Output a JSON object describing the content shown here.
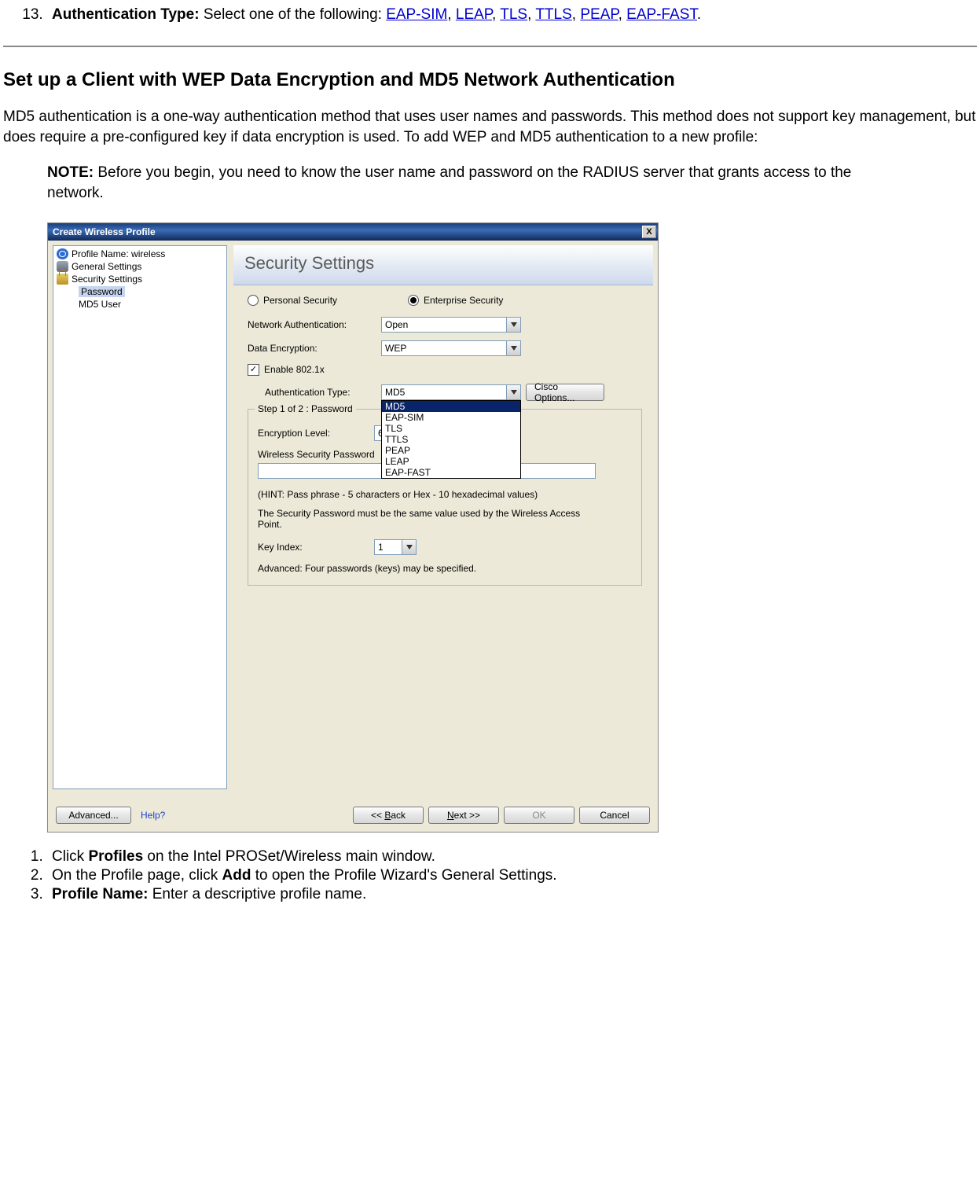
{
  "intro_list": {
    "item13": {
      "num": "13.",
      "label": "Authentication Type:",
      "tail": " Select one of the following: ",
      "links": [
        "EAP-SIM",
        "LEAP",
        "TLS",
        "TTLS",
        "PEAP",
        "EAP-FAST"
      ],
      "sep": ", ",
      "end": "."
    }
  },
  "section_heading": "Set up a Client with WEP Data Encryption and MD5 Network Authentication",
  "section_para": "MD5 authentication is a one-way authentication method that uses user names and passwords. This method does not support key management, but does require a pre-configured key if data encryption is used. To add WEP and MD5 authentication to a new profile:",
  "note": {
    "label": "NOTE:",
    "text": " Before you begin, you need to know the user name and password on the RADIUS server that grants access to the network."
  },
  "dialog": {
    "title": "Create Wireless Profile",
    "close_glyph": "X",
    "tree": {
      "row0": "Profile Name: wireless",
      "row1": "General Settings",
      "row2": "Security Settings",
      "row3": "Password",
      "row4": "MD5 User"
    },
    "header": "Security Settings",
    "radios": {
      "personal": "Personal Security",
      "enterprise": "Enterprise Security"
    },
    "labels": {
      "net_auth": "Network Authentication:",
      "data_enc": "Data Encryption:",
      "enable_8021x": "Enable 802.1x",
      "auth_type": "Authentication Type:",
      "enc_level": "Encryption Level:",
      "wsp": "Wireless Security Password",
      "hint": "(HINT: Pass phrase - 5 characters or Hex - 10 hexadecimal values)",
      "same_val": "The Security Password must be the same value used by the Wireless Access Point.",
      "key_index": "Key Index:",
      "advanced_note": "Advanced: Four passwords (keys) may be specified."
    },
    "values": {
      "net_auth": "Open",
      "data_enc": "WEP",
      "auth_type": "MD5",
      "enc_level": "64",
      "key_index": "1"
    },
    "auth_options": [
      "MD5",
      "EAP-SIM",
      "TLS",
      "TTLS",
      "PEAP",
      "LEAP",
      "EAP-FAST"
    ],
    "group_legend": "Step 1 of 2 : Password",
    "buttons": {
      "cisco": "Cisco Options...",
      "advanced": "Advanced...",
      "help": "Help?",
      "back": "<< Back",
      "next": "Next >>",
      "ok": "OK",
      "cancel": "Cancel"
    }
  },
  "steps": {
    "s1_a": "Click ",
    "s1_b": "Profiles",
    "s1_c": " on the Intel PROSet/Wireless main window.",
    "s2_a": "On the Profile page, click ",
    "s2_b": "Add",
    "s2_c": " to open the Profile Wizard's General Settings.",
    "s3_a": "Profile Name:",
    "s3_b": " Enter a descriptive profile name."
  }
}
